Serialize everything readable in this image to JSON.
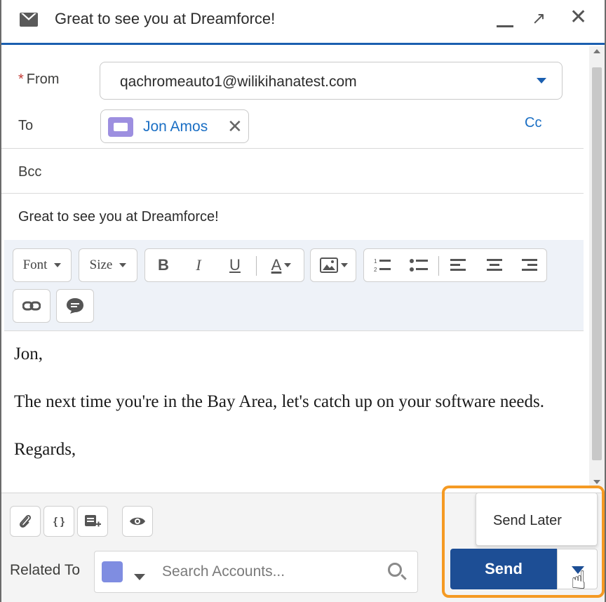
{
  "header": {
    "title": "Great to see you at Dreamforce!",
    "minimize_label": "__",
    "close_label": "✕"
  },
  "from": {
    "required_marker": "*",
    "label": "From",
    "value": "qachromeauto1@wilikihanatest.com"
  },
  "to": {
    "label": "To",
    "recipient": "Jon Amos",
    "remove_label": "✕",
    "cc_label": "Cc"
  },
  "bcc": {
    "label": "Bcc"
  },
  "subject": {
    "value": "Great to see you at Dreamforce!"
  },
  "toolbar": {
    "font_label": "Font",
    "size_label": "Size",
    "bold_label": "B",
    "italic_label": "I",
    "underline_label": "U",
    "text_color_label": "A"
  },
  "body": {
    "greeting": "Jon,",
    "paragraph": "The next time you're in the Bay Area, let's catch up on your software needs.",
    "closing": "Regards,"
  },
  "footer": {
    "merge_field_label": "{ }",
    "related_to_label": "Related To",
    "search_placeholder": "Search Accounts...",
    "send_later_label": "Send Later",
    "send_label": "Send"
  },
  "colors": {
    "accent_blue": "#1b5fb0",
    "send_button": "#1d4e95",
    "link_blue": "#1b6fc4",
    "highlight_orange": "#f59a23",
    "contact_icon": "#9d8fe0",
    "account_icon": "#7f8de1"
  }
}
